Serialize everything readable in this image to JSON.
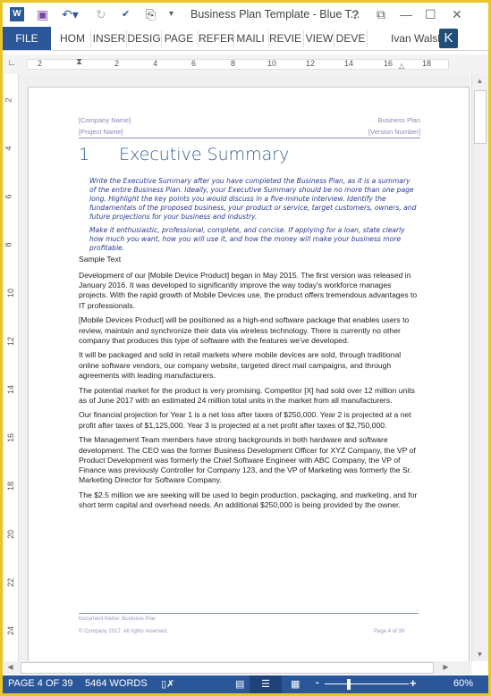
{
  "window": {
    "title": "Business Plan Template - Blue T...",
    "help": "?"
  },
  "quick_access": [
    "word-icon",
    "save-icon",
    "undo-icon",
    "redo-icon",
    "spelling-icon",
    "touch-mode-icon",
    "customize-icon"
  ],
  "ribbon": {
    "tabs": [
      "FILE",
      "HOM",
      "INSER",
      "DESIG",
      "PAGE",
      "REFER",
      "MAILI",
      "REVIE",
      "VIEW",
      "DEVE"
    ],
    "user": "Ivan Walsh",
    "avatar": "K"
  },
  "ruler": {
    "h": [
      "2",
      "2",
      "4",
      "6",
      "8",
      "10",
      "12",
      "14",
      "16",
      "18"
    ],
    "v": [
      "2",
      "4",
      "6",
      "8",
      "10",
      "12",
      "14",
      "16",
      "18",
      "20",
      "22",
      "24"
    ]
  },
  "document": {
    "header": {
      "company": "[Company Name]",
      "project": "[Project Name]",
      "doc": "Business Plan",
      "version": "[Version Number]"
    },
    "heading": {
      "number": "1",
      "title": "Executive Summary"
    },
    "instructions": [
      "Write the Executive Summary after you have completed the Business Plan, as it is a summary of the entire Business Plan. Ideally, your Executive Summary should be no more than one page long. Highlight the key points you would discuss in a five-minute interview. Identify the fundamentals of the proposed business, your product or service, target customers, owners, and future projections for your business and industry.",
      "Make it enthusiastic, professional, complete, and concise. If applying for a loan, state clearly how much you want, how you will use it, and how the money will make your business more profitable."
    ],
    "sample_label": "Sample Text",
    "paragraphs": [
      "Development of our [Mobile Device Product] began in May 2015. The first version was released in January 2016.  It was developed to significantly improve the way today's workforce manages projects.  With the rapid growth of Mobile Devices use, the product offers tremendous advantages to IT professionals.",
      "[Mobile Devices Product] will be positioned as a high-end software package that enables users to review, maintain and synchronize their data via wireless technology. There is currently no other company that produces this type of software with the features we've developed.",
      "It will be packaged and sold in retail markets where mobile devices are sold, through traditional online software vendors, our company website, targeted direct mail campaigns, and through agreements with leading manufacturers.",
      "The potential market for the product is very promising.  Competitor [X] had sold over 12 million units as of June 2017 with an estimated 24 million total units in the market from all manufacturers.",
      "Our financial projection for Year 1 is a net loss after taxes of $250,000. Year 2 is projected at a net profit after taxes of $1,125,000. Year 3 is projected at a net profit after taxes of $2,750,000.",
      "The Management Team members have strong backgrounds in both hardware and software development. The CEO was the former Business Development Officer for XYZ Company, the VP of Product Development was formerly the Chief Software Engineer with ABC Company, the VP of Finance was previously Controller for Company 123, and the VP of Marketing was formerly the Sr. Marketing Director for Software Company.",
      "The $2.5 million we are seeking will be used to begin production, packaging, and marketing, and for short term capital and overhead needs.  An additional $250,000 is being provided by the owner."
    ],
    "footer": {
      "doc_name": "Document Name: Business Plan",
      "copyright": "© Company 2017. All rights reserved.",
      "page": "Page 4 of 39"
    }
  },
  "status": {
    "page": "PAGE 4 OF 39",
    "words": "5464 WORDS",
    "zoom": "60%",
    "zoom_minus": "-",
    "zoom_plus": "+",
    "zoom_level_percent": 60
  },
  "colors": {
    "accent": "#2b579a",
    "border": "#e9c52a",
    "heading": "#365f91"
  }
}
